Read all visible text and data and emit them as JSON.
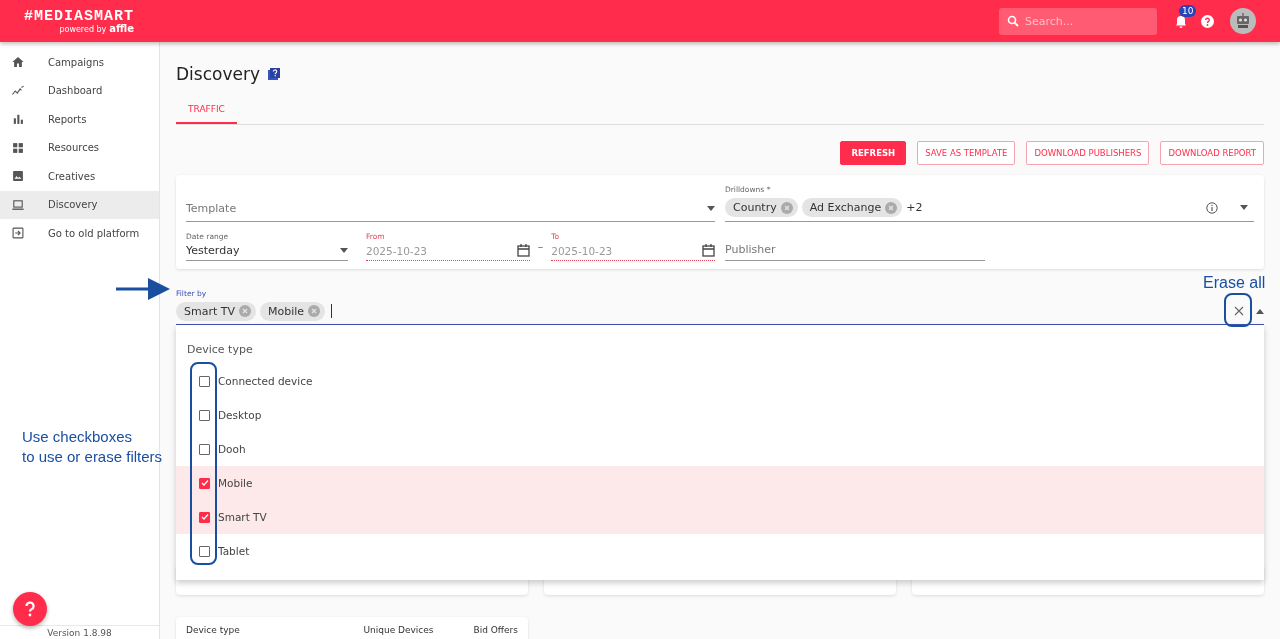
{
  "header": {
    "logo": {
      "title": "#MEDIASMART",
      "tagline": "powered by",
      "brand": "affle"
    },
    "search": {
      "placeholder": "Search..."
    },
    "notifications": {
      "count": "10"
    }
  },
  "sidebar": {
    "items": [
      {
        "label": "Campaigns",
        "selected": false
      },
      {
        "label": "Dashboard",
        "selected": false
      },
      {
        "label": "Reports",
        "selected": false
      },
      {
        "label": "Resources",
        "selected": false
      },
      {
        "label": "Creatives",
        "selected": false
      },
      {
        "label": "Discovery",
        "selected": true
      },
      {
        "label": "Go to old platform",
        "selected": false
      }
    ],
    "version": "Version 1.8.98"
  },
  "page": {
    "title": "Discovery"
  },
  "tabs": [
    {
      "label": "TRAFFIC",
      "selected": true
    }
  ],
  "buttons": [
    {
      "label": "REFRESH",
      "kind": "primary"
    },
    {
      "label": "SAVE AS TEMPLATE",
      "kind": "outline"
    },
    {
      "label": "DOWNLOAD PUBLISHERS",
      "kind": "outline"
    },
    {
      "label": "DOWNLOAD REPORT",
      "kind": "outline"
    }
  ],
  "filters": {
    "template": {
      "placeholder": "Template"
    },
    "drilldowns": {
      "label": "Drilldowns *",
      "chips": [
        "Country",
        "Ad Exchange"
      ],
      "more": "+2"
    },
    "date_range": {
      "label": "Date range",
      "value": "Yesterday"
    },
    "from": {
      "label": "From",
      "value": "2025-10-23"
    },
    "separator": "–",
    "to": {
      "label": "To",
      "value": "2025-10-23"
    },
    "publisher": {
      "placeholder": "Publisher"
    }
  },
  "filter_by": {
    "label": "Filter by",
    "chips": [
      "Smart TV",
      "Mobile"
    ]
  },
  "dropdown": {
    "heading": "Device type",
    "options": [
      {
        "label": "Connected device",
        "checked": false
      },
      {
        "label": "Desktop",
        "checked": false
      },
      {
        "label": "Dooh",
        "checked": false
      },
      {
        "label": "Mobile",
        "checked": true
      },
      {
        "label": "Smart TV",
        "checked": true
      },
      {
        "label": "Tablet",
        "checked": false
      }
    ]
  },
  "table": {
    "columns": [
      "Device type",
      "Unique Devices",
      "Bid Offers"
    ]
  },
  "annotations": {
    "erase_all": "Erase all",
    "checkbox_note": [
      "Use checkboxes",
      "to use or erase filters"
    ]
  }
}
